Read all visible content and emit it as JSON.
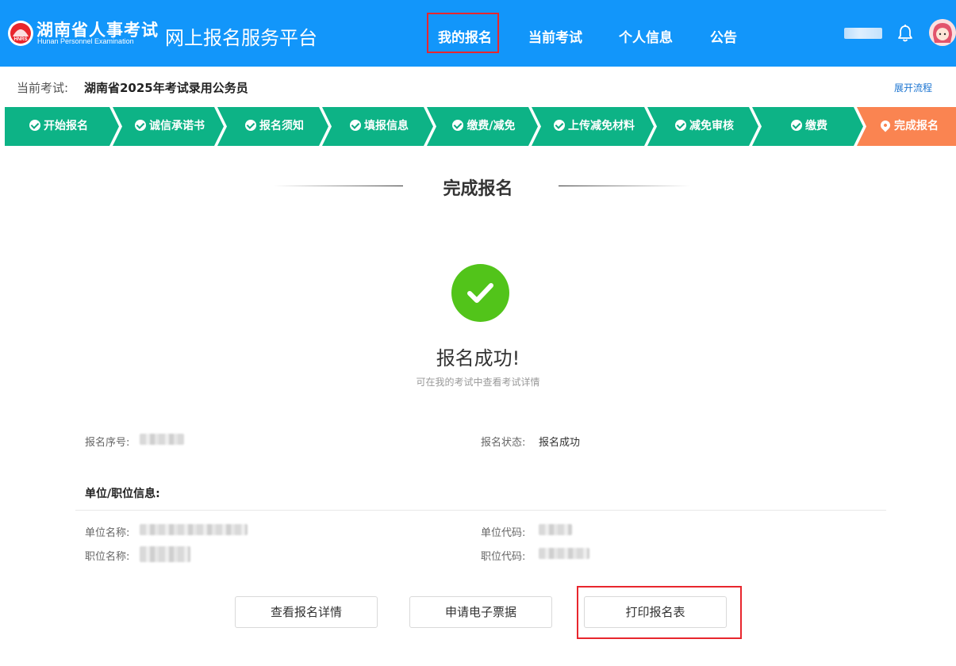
{
  "header": {
    "logo_cn": "湖南省人事考试",
    "logo_en": "Hunan Personnel Examination",
    "logo_badge": "HNRS",
    "platform_name": "网上报名服务平台",
    "nav": [
      {
        "label": "我的报名"
      },
      {
        "label": "当前考试"
      },
      {
        "label": "个人信息"
      },
      {
        "label": "公告"
      }
    ],
    "active_nav": "我的报名"
  },
  "exam_bar": {
    "label": "当前考试:",
    "value": "湖南省2025年考试录用公务员",
    "expand_link": "展开流程"
  },
  "steps": [
    {
      "label": "开始报名",
      "status": "done"
    },
    {
      "label": "诚信承诺书",
      "status": "done"
    },
    {
      "label": "报名须知",
      "status": "done"
    },
    {
      "label": "填报信息",
      "status": "done"
    },
    {
      "label": "缴费/减免",
      "status": "done"
    },
    {
      "label": "上传减免材料",
      "status": "done"
    },
    {
      "label": "减免审核",
      "status": "done"
    },
    {
      "label": "缴费",
      "status": "done"
    },
    {
      "label": "完成报名",
      "status": "current"
    }
  ],
  "colors": {
    "header_bg": "#1296fa",
    "step_done": "#0db386",
    "step_current": "#fa8451",
    "success": "#52c41a",
    "highlight_border": "#e8262d",
    "link": "#1b74d1"
  },
  "main": {
    "section_title": "完成报名",
    "success_title": "报名成功!",
    "success_subtitle": "可在我的考试中查看考试详情",
    "reg_no_label": "报名序号:",
    "reg_status_label": "报名状态:",
    "reg_status_value": "报名成功",
    "unit_heading": "单位/职位信息:",
    "unit_name_label": "单位名称:",
    "unit_code_label": "单位代码:",
    "position_name_label": "职位名称:",
    "position_code_label": "职位代码:"
  },
  "buttons": {
    "view_details": "查看报名详情",
    "apply_receipt": "申请电子票据",
    "print_form": "打印报名表"
  },
  "icons": {
    "step_done": "check-circle-icon",
    "step_current": "location-pin-icon",
    "success": "check-icon",
    "notifications": "bell-icon"
  }
}
